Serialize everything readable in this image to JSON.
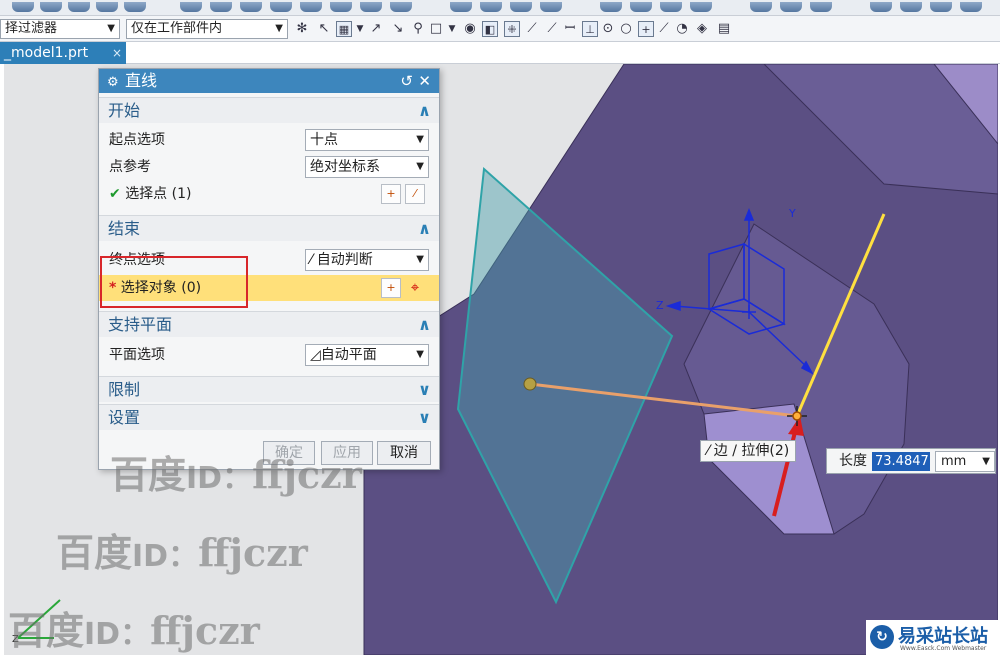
{
  "toolbar": {
    "filter_combo": "择过滤器",
    "scope_combo": "仅在工作部件内"
  },
  "tab": {
    "label": "_model1.prt",
    "close": "×"
  },
  "dialog": {
    "title": "直线",
    "reset_icon": "reset-icon",
    "close_icon": "close-icon",
    "start": {
      "header": "开始",
      "start_option_label": "起点选项",
      "start_option_value": "十点",
      "point_ref_label": "点参考",
      "point_ref_value": "绝对坐标系",
      "select_point": "选择点 (1)"
    },
    "end": {
      "header": "结束",
      "end_option_label": "终点选项",
      "end_option_value": "自动判断",
      "select_object": "选择对象 (0)"
    },
    "support": {
      "header": "支持平面",
      "plane_option_label": "平面选项",
      "plane_option_value": "自动平面"
    },
    "limits_header": "限制",
    "settings_header": "设置",
    "buttons": {
      "ok": "确定",
      "apply": "应用",
      "cancel": "取消"
    }
  },
  "viewport": {
    "snap_tip": "边 / 拉伸(2)",
    "length_label": "长度",
    "length_value": "73.4847",
    "length_unit": "mm",
    "axis_y": "Y",
    "axis_z": "Z"
  },
  "watermarks": [
    {
      "prefix": "百度",
      "id": "ID：",
      "name": "ffjczr"
    },
    {
      "prefix": "百度",
      "id": "ID：",
      "name": "ffjczr"
    },
    {
      "prefix": "百度",
      "id": "ID：",
      "name": "ffjczr"
    }
  ],
  "brand": {
    "name": "易采站长站",
    "sub": "Www.Easck.Com Webmaster"
  }
}
